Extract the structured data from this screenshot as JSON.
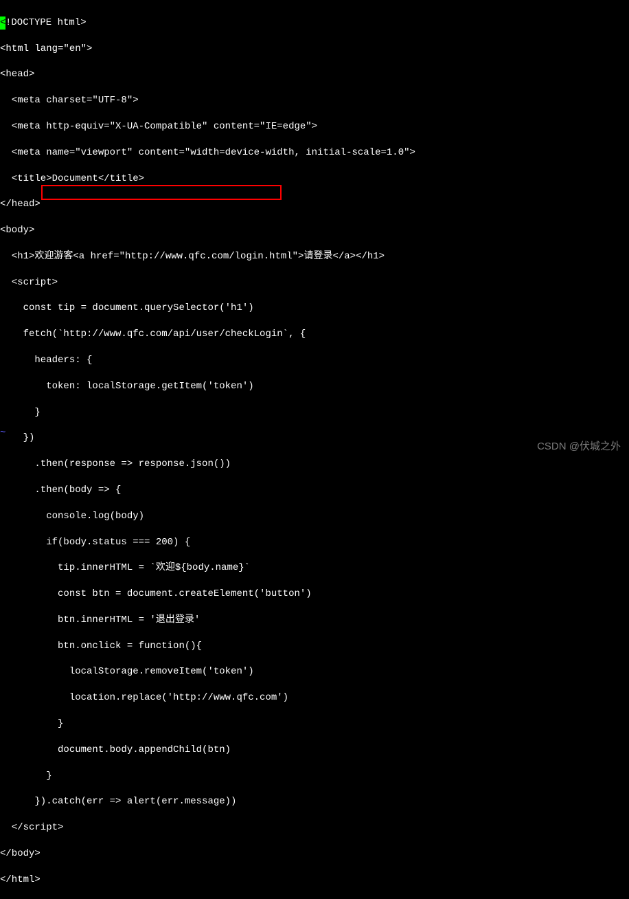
{
  "code": {
    "lines": [
      "<!DOCTYPE html>",
      "<html lang=\"en\">",
      "<head>",
      "  <meta charset=\"UTF-8\">",
      "  <meta http-equiv=\"X-UA-Compatible\" content=\"IE=edge\">",
      "  <meta name=\"viewport\" content=\"width=device-width, initial-scale=1.0\">",
      "  <title>Document</title>",
      "</head>",
      "<body>",
      "  <h1>欢迎游客<a href=\"http://www.qfc.com/login.html\">请登录</a></h1>",
      "  <script>",
      "    const tip = document.querySelector('h1')",
      "    fetch(`http://www.qfc.com/api/user/checkLogin`, {",
      "      headers: {",
      "        token: localStorage.getItem('token')",
      "      }",
      "    })",
      "      .then(response => response.json())",
      "      .then(body => {",
      "        console.log(body)",
      "        if(body.status === 200) {",
      "          tip.innerHTML = `欢迎${body.name}`",
      "          const btn = document.createElement('button')",
      "          btn.innerHTML = '退出登录'",
      "          btn.onclick = function(){",
      "            localStorage.removeItem('token')",
      "            location.replace('http://www.qfc.com')",
      "          }",
      "          document.body.appendChild(btn)",
      "        }",
      "      }).catch(err => alert(err.message))",
      "  </script>",
      "</body>",
      "</html>"
    ]
  },
  "highlight": {
    "line_index": 14,
    "text": "token: localStorage.getItem('token')"
  },
  "watermark": "CSDN @伏城之外",
  "tilde": "~",
  "colors": {
    "background": "#000000",
    "text": "#ffffff",
    "cursor": "#00ff00",
    "highlight_border": "#ff0000",
    "tilde": "#5c5cff"
  }
}
